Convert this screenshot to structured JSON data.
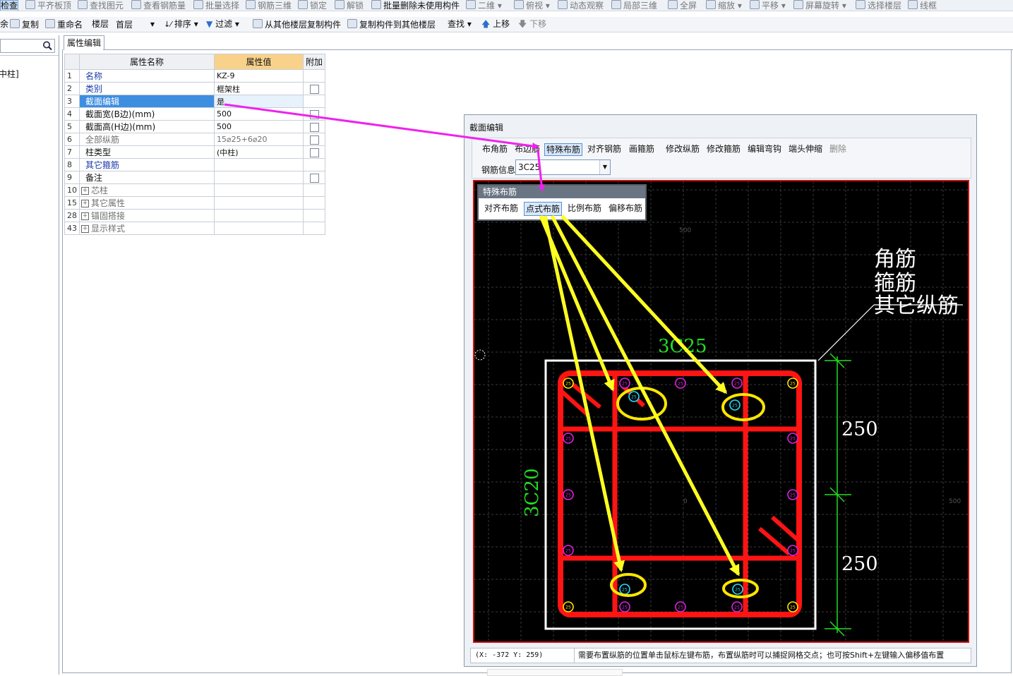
{
  "toolbar1": {
    "items": [
      "检查",
      "平齐板顶",
      "查找图元",
      "查看钢筋量",
      "批量选择",
      "钢筋三维",
      "锁定",
      "解锁",
      "批量删除未使用构件",
      "二维",
      "俯视",
      "动态观察",
      "局部三维",
      "全屏",
      "缩放",
      "平移",
      "屏幕旋转",
      "选择楼层",
      "线框"
    ]
  },
  "toolbar2": {
    "delete": "余",
    "copy": "复制",
    "rename": "重命名",
    "floor_label": "楼层",
    "floor_value": "首层",
    "sort": "排序",
    "filter": "过滤",
    "copy_from_other": "从其他楼层复制构件",
    "copy_to_other": "复制构件到其他楼层",
    "find": "查找",
    "move_up": "上移",
    "move_down": "下移"
  },
  "left_panel": {
    "tree_item": "中柱]"
  },
  "property_editor": {
    "tab": "属性编辑",
    "headers": {
      "name": "属性名称",
      "value": "属性值",
      "extra": "附加"
    },
    "rows": [
      {
        "num": "1",
        "name": "名称",
        "value": "KZ-9",
        "style": "blue",
        "check": false,
        "expander": false
      },
      {
        "num": "2",
        "name": "类别",
        "value": "框架柱",
        "style": "blue",
        "check": true,
        "expander": false
      },
      {
        "num": "3",
        "name": "截面编辑",
        "value": "是",
        "style": "sel",
        "check": false,
        "expander": false
      },
      {
        "num": "4",
        "name": "截面宽(B边)(mm)",
        "value": "500",
        "style": "black",
        "check": true,
        "expander": false
      },
      {
        "num": "5",
        "name": "截面高(H边)(mm)",
        "value": "500",
        "style": "black",
        "check": true,
        "expander": false
      },
      {
        "num": "6",
        "name": "全部纵筋",
        "value": "15⌀25+6⌀20",
        "style": "gray",
        "check": true,
        "expander": false
      },
      {
        "num": "7",
        "name": "柱类型",
        "value": "(中柱)",
        "style": "black",
        "check": true,
        "expander": false
      },
      {
        "num": "8",
        "name": "其它箍筋",
        "value": "",
        "style": "blue",
        "check": false,
        "expander": false
      },
      {
        "num": "9",
        "name": "备注",
        "value": "",
        "style": "black",
        "check": true,
        "expander": false
      },
      {
        "num": "10",
        "name": "芯柱",
        "value": "",
        "style": "gray",
        "check": false,
        "expander": true
      },
      {
        "num": "15",
        "name": "其它属性",
        "value": "",
        "style": "gray",
        "check": false,
        "expander": true
      },
      {
        "num": "28",
        "name": "锚固搭接",
        "value": "",
        "style": "gray",
        "check": false,
        "expander": true
      },
      {
        "num": "43",
        "name": "显示样式",
        "value": "",
        "style": "gray",
        "check": false,
        "expander": true
      }
    ]
  },
  "dialog": {
    "title": "截面编辑",
    "buttons": [
      "布角筋",
      "布边筋",
      "特殊布筋",
      "对齐钢筋",
      "画箍筋",
      "修改纵筋",
      "修改箍筋",
      "编辑弯钩",
      "端头伸缩",
      "删除"
    ],
    "rebar_info_label": "钢筋信息",
    "rebar_info_value": "3C25",
    "popup": {
      "title": "特殊布筋",
      "buttons": [
        "对齐布筋",
        "点式布筋",
        "比例布筋",
        "偏移布筋"
      ]
    },
    "canvas": {
      "dim_top": "3C25",
      "dim_left": "3C20",
      "dim_250_a": "250",
      "dim_250_b": "250",
      "legend": [
        "角筋",
        "箍筋",
        "其它纵筋"
      ],
      "axis_500_top": "500",
      "axis_500_right": "500",
      "axis_0": "0",
      "bar_label": "25"
    },
    "status": {
      "coord": "(X: -372 Y: 259)",
      "message": "需要布置纵筋的位置单击鼠标左键布筋，布置纵筋时可以捕捉网格交点；也可按Shift+左键输入偏移值布置"
    }
  },
  "colors": {
    "stirrup": "#ff1414",
    "corner_bar": "#ffe600",
    "side_bar": "#e020e0",
    "placed_bar": "#20e0ff",
    "dimension": "#22dd22",
    "arrow_yellow": "#ffff22",
    "arrow_magenta": "#ee22ee"
  }
}
